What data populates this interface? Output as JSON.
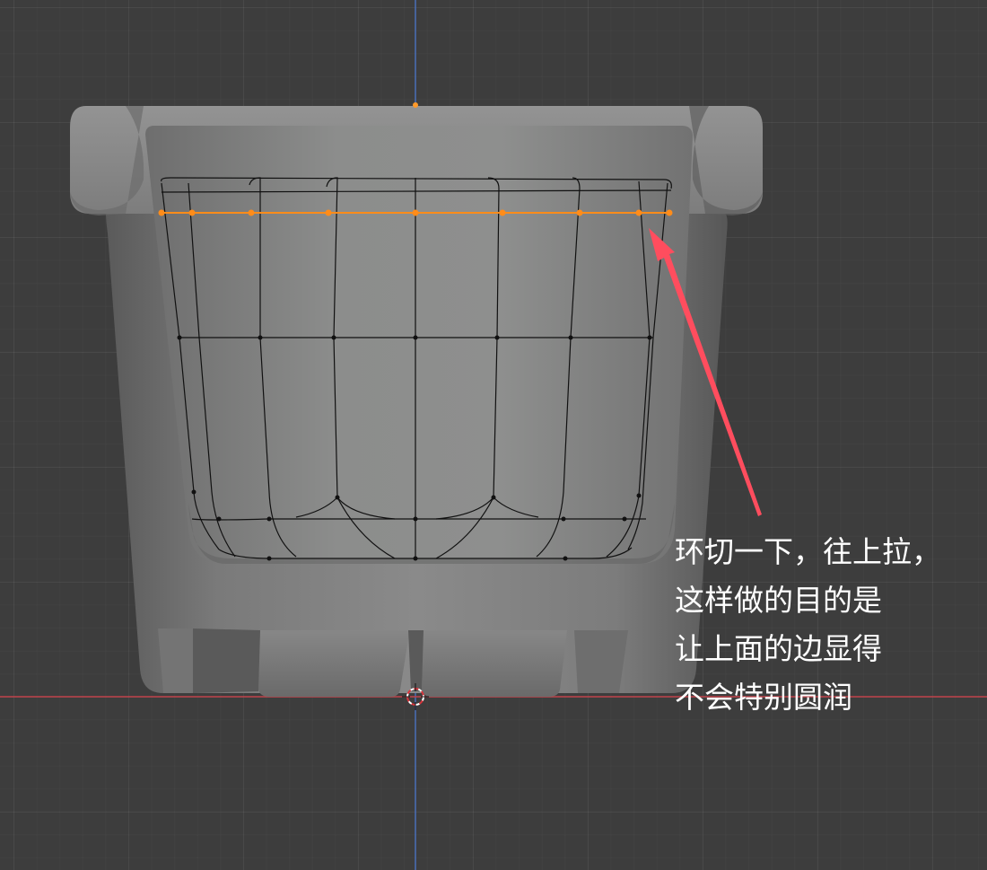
{
  "viewport": {
    "background_color": "#3d3d3d",
    "x_axis_color": "#c0424a",
    "z_axis_color": "#4a6fb8",
    "selection_color": "#ff8c1a",
    "wire_color": "#111111",
    "arrow_color": "#ff4d5e"
  },
  "annotation": {
    "lines": [
      "环切一下，往上拉，",
      "这样做的目的是",
      "让上面的边显得",
      "不会特别圆润"
    ]
  }
}
